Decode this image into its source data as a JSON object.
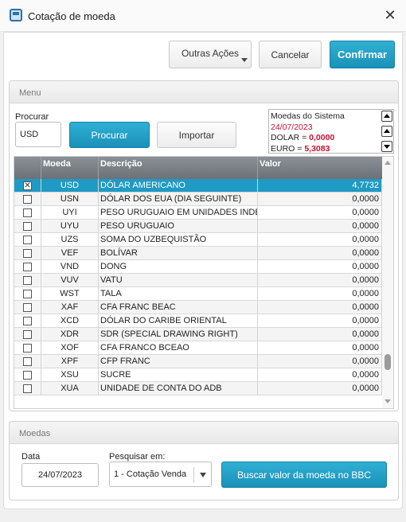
{
  "window": {
    "title": "Cotação de moeda"
  },
  "toolbar": {
    "outras_acoes": "Outras Ações",
    "cancelar": "Cancelar",
    "confirmar": "Confirmar"
  },
  "menu": {
    "header": "Menu",
    "procurar_label": "Procurar",
    "codigo_value": "USD",
    "procurar_button": "Procurar",
    "importar_button": "Importar",
    "system": {
      "title": "Moedas do Sistema",
      "date": "24/07/2023",
      "dolar_label": "DOLAR = ",
      "dolar_value": "0,0000",
      "euro_label": "EURO = ",
      "euro_value": "5,3083"
    }
  },
  "grid": {
    "columns": [
      "Moeda",
      "Descrição",
      "Valor"
    ],
    "rows": [
      {
        "checked": true,
        "selected": true,
        "code": "USD",
        "desc": "DÓLAR AMERICANO",
        "value": "4,7732"
      },
      {
        "checked": false,
        "code": "USN",
        "desc": "DÓLAR DOS EUA (DIA SEGUINTE)",
        "value": "0,0000"
      },
      {
        "checked": false,
        "code": "UYI",
        "desc": "PESO URUGUAIO EM UNIDADES INDEXADAS",
        "value": "0,0000"
      },
      {
        "checked": false,
        "code": "UYU",
        "desc": "PESO URUGUAIO",
        "value": "0,0000"
      },
      {
        "checked": false,
        "code": "UZS",
        "desc": "SOMA DO UZBEQUISTÃO",
        "value": "0,0000"
      },
      {
        "checked": false,
        "code": "VEF",
        "desc": "BOLÍVAR",
        "value": "0,0000"
      },
      {
        "checked": false,
        "code": "VND",
        "desc": "DONG",
        "value": "0,0000"
      },
      {
        "checked": false,
        "code": "VUV",
        "desc": "VATU",
        "value": "0,0000"
      },
      {
        "checked": false,
        "code": "WST",
        "desc": "TALA",
        "value": "0,0000"
      },
      {
        "checked": false,
        "code": "XAF",
        "desc": "CFA FRANC BEAC",
        "value": "0,0000"
      },
      {
        "checked": false,
        "code": "XCD",
        "desc": "DÓLAR DO CARIBE ORIENTAL",
        "value": "0,0000"
      },
      {
        "checked": false,
        "code": "XDR",
        "desc": "SDR (SPECIAL DRAWING RIGHT)",
        "value": "0,0000"
      },
      {
        "checked": false,
        "code": "XOF",
        "desc": "CFA FRANCO BCEAO",
        "value": "0,0000"
      },
      {
        "checked": false,
        "code": "XPF",
        "desc": "CFP FRANC",
        "value": "0,0000"
      },
      {
        "checked": false,
        "code": "XSU",
        "desc": "SUCRE",
        "value": "0,0000"
      },
      {
        "checked": false,
        "code": "XUA",
        "desc": "UNIDADE DE CONTA DO ADB",
        "value": "0,0000"
      }
    ]
  },
  "moedas": {
    "header": "Moedas",
    "data_label": "Data",
    "data_value": "24/07/2023",
    "pesquisar_label": "Pesquisar em:",
    "pesquisar_value": "1 - Cotação Venda",
    "bbc_button": "Buscar valor da moeda no BBC"
  }
}
